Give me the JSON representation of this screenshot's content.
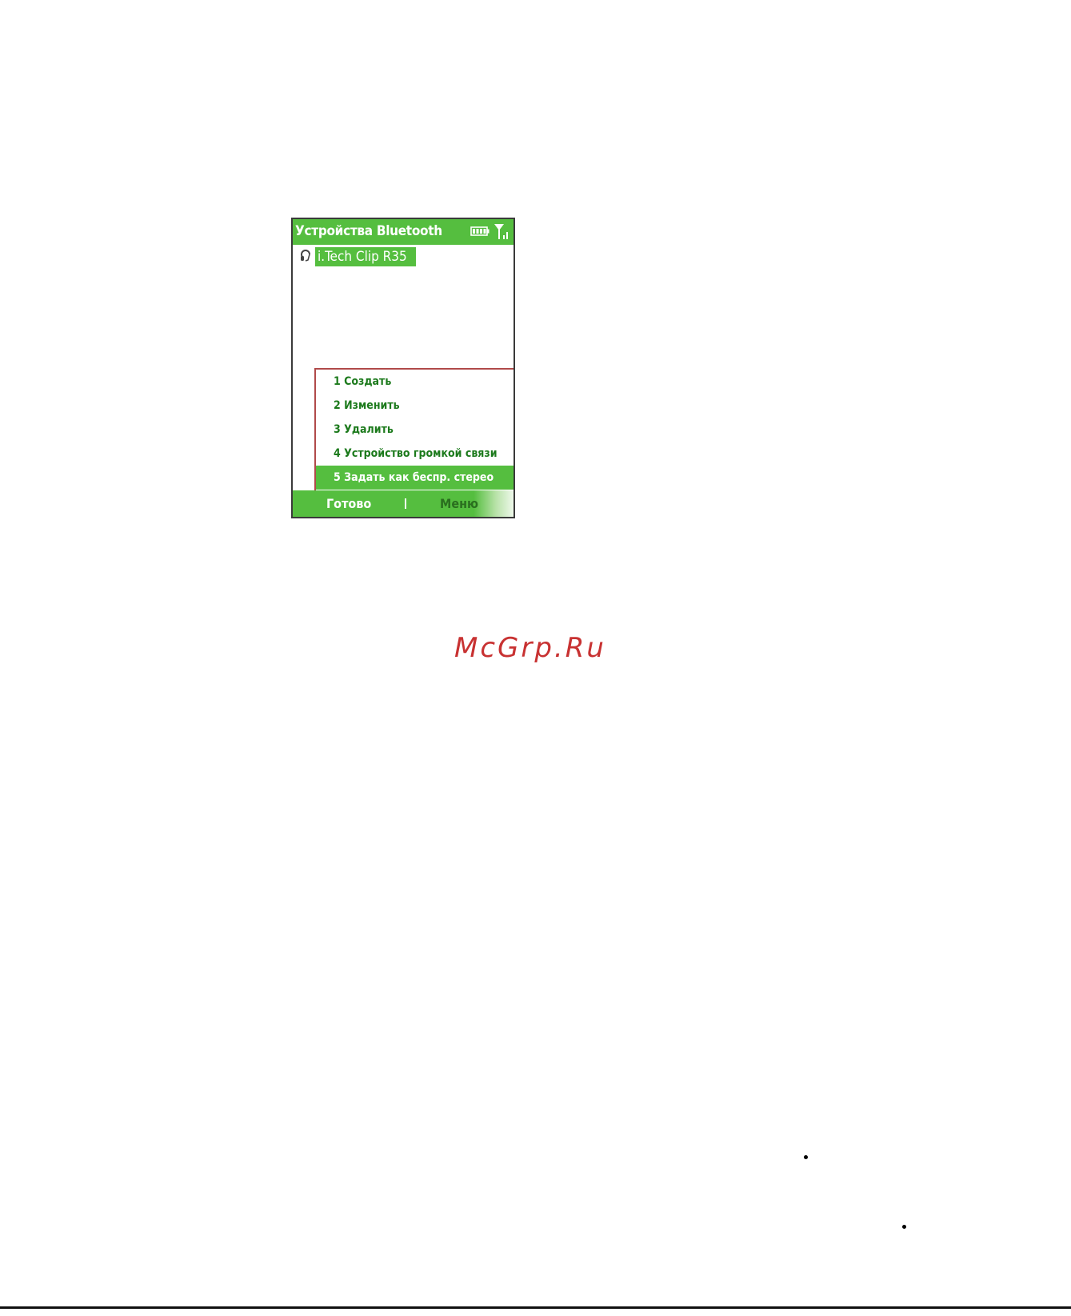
{
  "screen": {
    "title": "Устройства Bluetooth",
    "device": {
      "name": "i.Tech Clip R35",
      "icon": "headset-icon"
    },
    "status_icons": [
      "battery-icon",
      "signal-icon"
    ],
    "menu": {
      "items": [
        {
          "label": "1 Создать"
        },
        {
          "label": "2 Изменить"
        },
        {
          "label": "3 Удалить"
        },
        {
          "label": "4 Устройство громкой связи"
        },
        {
          "label": "5 Задать как беспр. стерео"
        }
      ],
      "selected_index": 4
    },
    "softkeys": {
      "left": "Готово",
      "right": "Меню"
    }
  },
  "watermark": "McGrp.Ru",
  "colors": {
    "accent_green": "#55be3f",
    "menu_text": "#1c7a1c",
    "menu_border": "#b04a4a",
    "watermark": "#c83232"
  }
}
